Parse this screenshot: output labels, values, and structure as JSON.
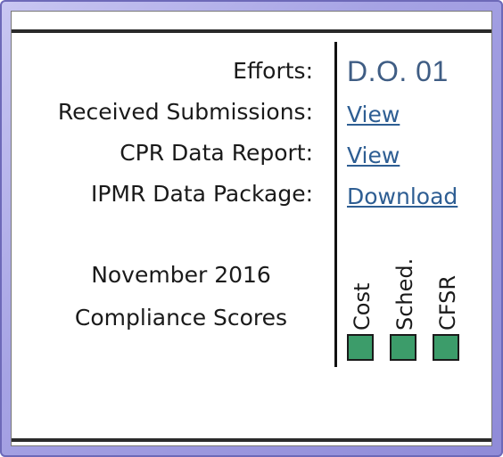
{
  "rows": [
    {
      "label": "Efforts:",
      "value": "D.O. 01"
    },
    {
      "label": "Received Submissions:",
      "link": "View"
    },
    {
      "label": "CPR Data Report:",
      "link": "View"
    },
    {
      "label": "IPMR Data Package:",
      "link": "Download"
    }
  ],
  "compliance": {
    "line1": "November 2016",
    "line2": "Compliance Scores"
  },
  "scores": [
    {
      "label": "Cost",
      "color": "#3c9c6a"
    },
    {
      "label": "Sched.",
      "color": "#3c9c6a"
    },
    {
      "label": "CFSR",
      "color": "#3c9c6a"
    }
  ],
  "colors": {
    "frame": "#a6a3e4",
    "link": "#2e5e93",
    "efforts_value": "#3f5d84",
    "score_green": "#3c9c6a"
  }
}
